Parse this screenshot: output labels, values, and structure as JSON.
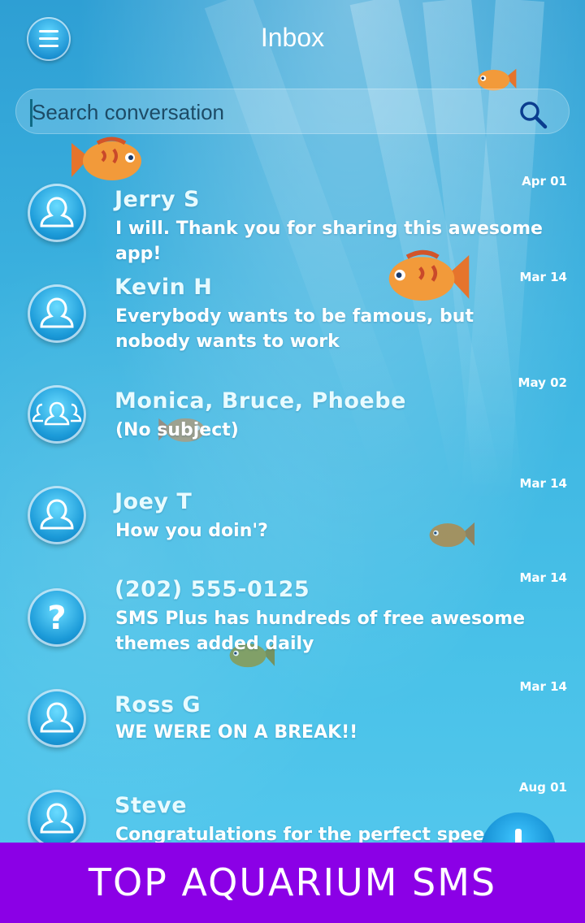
{
  "header": {
    "title": "Inbox"
  },
  "search": {
    "placeholder": "Search conversation"
  },
  "conversations": [
    {
      "name": "Jerry S",
      "message": "I will. Thank you for sharing this awesome app!",
      "date": "Apr 01",
      "avatar": "person-icon"
    },
    {
      "name": "Kevin H",
      "message": "Everybody wants to be famous, but nobody wants to work",
      "date": "Mar 14",
      "avatar": "person-icon"
    },
    {
      "name": "Monica, Bruce, Phoebe",
      "message": "(No subject)",
      "date": "May 02",
      "avatar": "group-icon"
    },
    {
      "name": "Joey T",
      "message": "How you doin'?",
      "date": "Mar 14",
      "avatar": "person-icon"
    },
    {
      "name": "(202) 555-0125",
      "message": "SMS Plus has hundreds of free awesome themes added daily",
      "date": "Mar 14",
      "avatar": "question-icon"
    },
    {
      "name": "Ross G",
      "message": "WE WERE ON A BREAK!!",
      "date": "Mar 14",
      "avatar": "person-icon"
    },
    {
      "name": "Steve",
      "message": "Congratulations for the perfect speech held t",
      "date": "Aug 01",
      "avatar": "person-icon"
    }
  ],
  "banner": {
    "text": "TOP AQUARIUM  SMS"
  },
  "colors": {
    "banner": "#8b00e6",
    "background": "#3cb3e0",
    "accent": "#1b9ad8"
  }
}
